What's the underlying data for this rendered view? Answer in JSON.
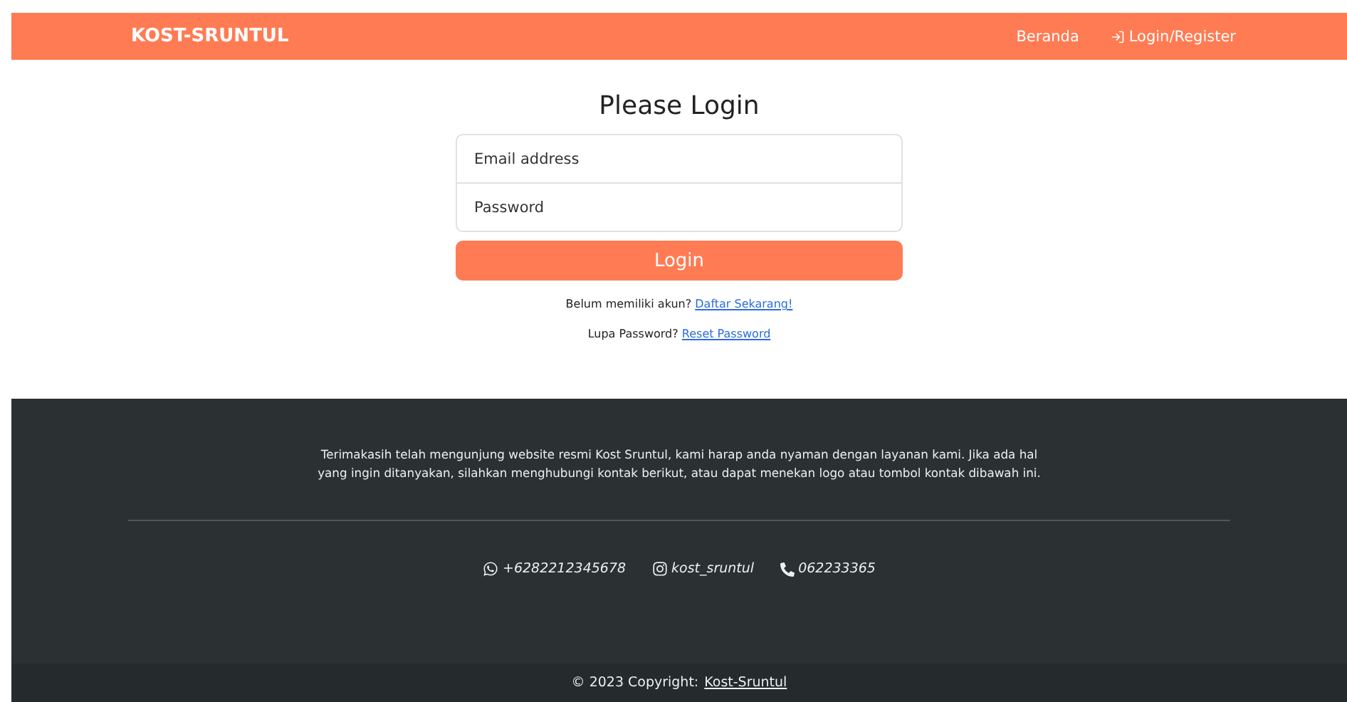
{
  "navbar": {
    "brand": "KOST-SRUNTUL",
    "links": [
      {
        "label": "Beranda",
        "kind": "plain"
      },
      {
        "label": "Login/Register",
        "kind": "login"
      }
    ]
  },
  "login": {
    "title": "Please Login",
    "fields": [
      {
        "placeholder": "Email address"
      },
      {
        "placeholder": "Password"
      }
    ],
    "button": "Login",
    "prompts": [
      {
        "text": "Belum memiliki akun?",
        "link": "Daftar Sekarang!"
      },
      {
        "text": "Lupa Password?",
        "link": "Reset Password"
      }
    ]
  },
  "footer": {
    "message": "Terimakasih telah mengunjung website resmi Kost Sruntul, kami harap anda nyaman dengan layanan kami. Jika ada hal yang ingin ditanyakan, silahkan menghubungi kontak berikut, atau dapat menekan logo atau tombol kontak dibawah ini.",
    "contacts": [
      {
        "kind": "whatsapp",
        "label": "+6282212345678"
      },
      {
        "kind": "instagram",
        "label": "kost_sruntul"
      },
      {
        "kind": "phone",
        "label": "062233365"
      }
    ],
    "copyright": {
      "text": "© 2023 Copyright:",
      "link": "Kost-Sruntul"
    }
  }
}
